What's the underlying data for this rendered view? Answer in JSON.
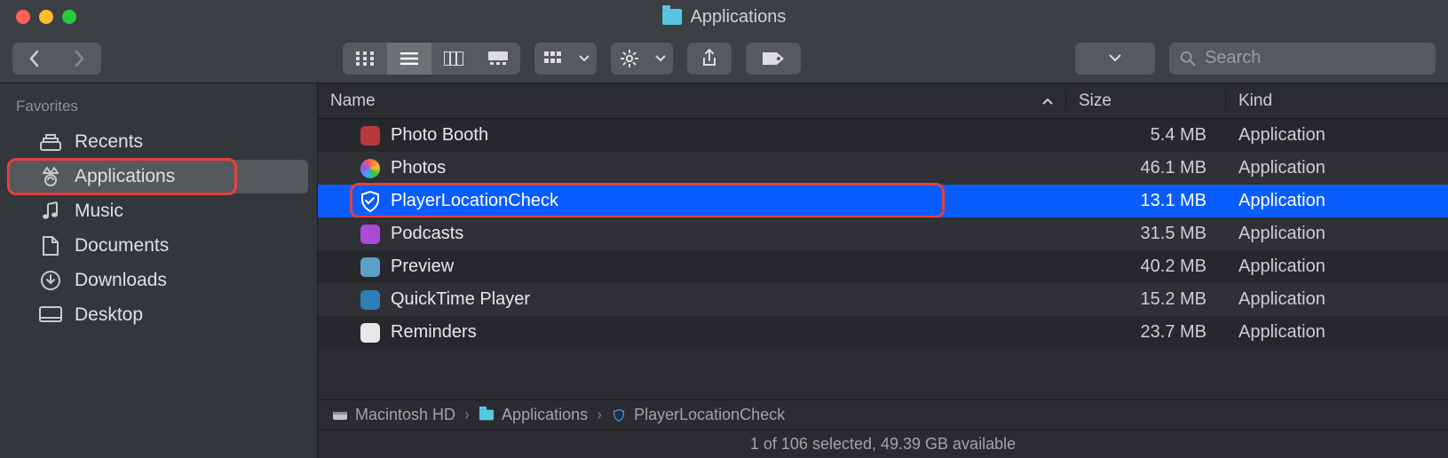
{
  "window": {
    "title": "Applications"
  },
  "sidebar": {
    "header": "Favorites",
    "items": [
      {
        "label": "Recents",
        "icon": "recents"
      },
      {
        "label": "Applications",
        "icon": "applications",
        "active": true,
        "highlighted": true
      },
      {
        "label": "Music",
        "icon": "music"
      },
      {
        "label": "Documents",
        "icon": "documents"
      },
      {
        "label": "Downloads",
        "icon": "downloads"
      },
      {
        "label": "Desktop",
        "icon": "desktop"
      }
    ]
  },
  "columns": {
    "name": "Name",
    "size": "Size",
    "kind": "Kind",
    "sort_asc_on": "name"
  },
  "rows": [
    {
      "name": "Photo Booth",
      "size": "5.4 MB",
      "kind": "Application",
      "icon_color": "#b93a3a"
    },
    {
      "name": "Photos",
      "size": "46.1 MB",
      "kind": "Application",
      "icon_color": "linear"
    },
    {
      "name": "PlayerLocationCheck",
      "size": "13.1 MB",
      "kind": "Application",
      "icon_color": "#1e88ff",
      "selected": true,
      "highlighted": true,
      "icon": "shield"
    },
    {
      "name": "Podcasts",
      "size": "31.5 MB",
      "kind": "Application",
      "icon_color": "#a94bd6"
    },
    {
      "name": "Preview",
      "size": "40.2 MB",
      "kind": "Application",
      "icon_color": "#5aa0c8"
    },
    {
      "name": "QuickTime Player",
      "size": "15.2 MB",
      "kind": "Application",
      "icon_color": "#2d7fb5"
    },
    {
      "name": "Reminders",
      "size": "23.7 MB",
      "kind": "Application",
      "icon_color": "#e8e8e8"
    }
  ],
  "path": [
    {
      "label": "Macintosh HD",
      "icon": "disk"
    },
    {
      "label": "Applications",
      "icon": "folder"
    },
    {
      "label": "PlayerLocationCheck",
      "icon": "shield"
    }
  ],
  "status": "1 of 106 selected, 49.39 GB available",
  "search": {
    "placeholder": "Search"
  }
}
